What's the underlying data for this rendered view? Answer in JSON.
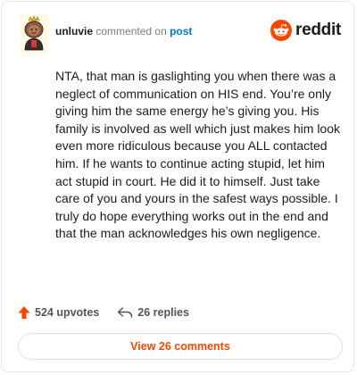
{
  "comment": {
    "username": "unluvie",
    "action_text": "commented on",
    "post_link": "post",
    "body": "NTA, that man is gaslighting you when there was a neglect of communication on HIS end. You’re only giving him the same energy he’s giving you. His family is involved as well which just makes him look even more ridiculous because you ALL contacted him. If he wants to continue acting stupid, let him act stupid in court. He did it to himself. Just take care of you and yours in the safest ways possible. I truly do hope everything works out in the end and that the man acknowledges his own negligence.",
    "upvotes": "524 upvotes",
    "replies": "26 replies"
  },
  "brand": {
    "wordmark": "reddit",
    "color": "#ff4500"
  },
  "footer": {
    "view_button_label": "View 26 comments"
  },
  "colors": {
    "accent": "#ff4500",
    "link": "#0079d3",
    "muted": "#7c7c7c"
  },
  "icons": {
    "avatar": "user-avatar",
    "logo": "reddit-alien-icon",
    "upvote": "upvote-arrow-icon",
    "reply": "reply-arrow-icon"
  }
}
